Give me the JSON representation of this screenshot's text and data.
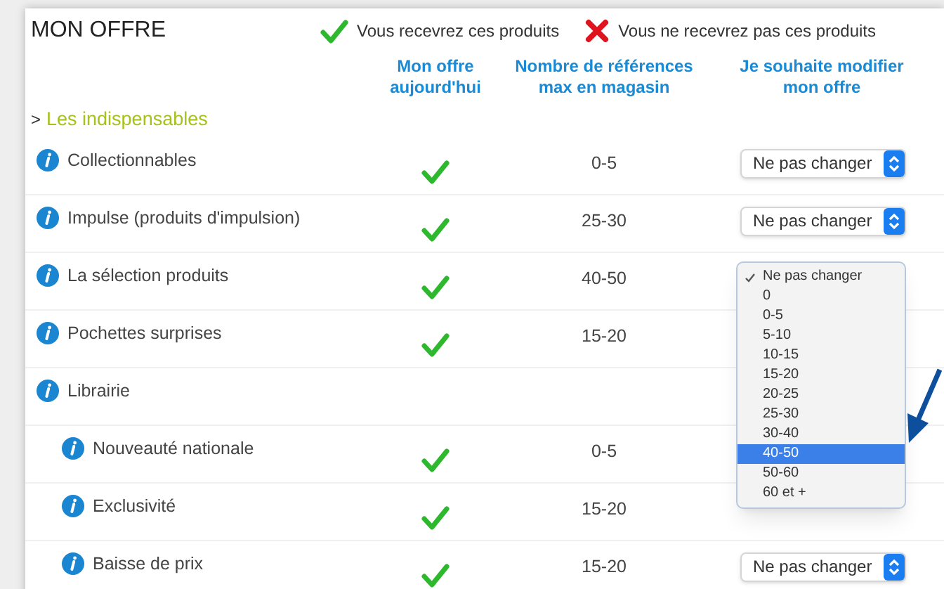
{
  "title": "MON OFFRE",
  "legend": [
    {
      "kind": "yes",
      "label": "Vous recevrez ces produits"
    },
    {
      "kind": "no",
      "label": "Vous ne recevrez pas ces produits"
    }
  ],
  "columns": [
    "Mon offre aujourd'hui",
    "Nombre de références max en magasin",
    "Je souhaite modifier mon offre"
  ],
  "section": {
    "marker": ">",
    "label": "Les indispensables"
  },
  "rows": [
    {
      "label": "Collectionnables",
      "offer": true,
      "count": "0-5",
      "select": {
        "value": "Ne pas changer"
      }
    },
    {
      "label": "Impulse (produits d'impulsion)",
      "offer": true,
      "count": "25-30",
      "select": {
        "value": "Ne pas changer"
      }
    },
    {
      "label": "La sélection produits",
      "offer": true,
      "count": "40-50",
      "dropdown": {
        "options": [
          {
            "label": "Ne pas changer",
            "checked": true,
            "selected": false
          },
          {
            "label": "0",
            "checked": false,
            "selected": false
          },
          {
            "label": "0-5",
            "checked": false,
            "selected": false
          },
          {
            "label": "5-10",
            "checked": false,
            "selected": false
          },
          {
            "label": "10-15",
            "checked": false,
            "selected": false
          },
          {
            "label": "15-20",
            "checked": false,
            "selected": false
          },
          {
            "label": "20-25",
            "checked": false,
            "selected": false
          },
          {
            "label": "25-30",
            "checked": false,
            "selected": false
          },
          {
            "label": "30-40",
            "checked": false,
            "selected": false
          },
          {
            "label": "40-50",
            "checked": false,
            "selected": true
          },
          {
            "label": "50-60",
            "checked": false,
            "selected": false
          },
          {
            "label": "60 et +",
            "checked": false,
            "selected": false
          }
        ]
      }
    },
    {
      "label": "Pochettes surprises",
      "offer": true,
      "count": "15-20"
    },
    {
      "label": "Librairie",
      "children": [
        {
          "label": "Nouveauté nationale",
          "offer": true,
          "count": "0-5"
        },
        {
          "label": "Exclusivité",
          "offer": true,
          "count": "15-20"
        },
        {
          "label": "Baisse de prix",
          "offer": true,
          "count": "15-20",
          "select": {
            "value": "Ne pas changer"
          }
        }
      ]
    }
  ]
}
